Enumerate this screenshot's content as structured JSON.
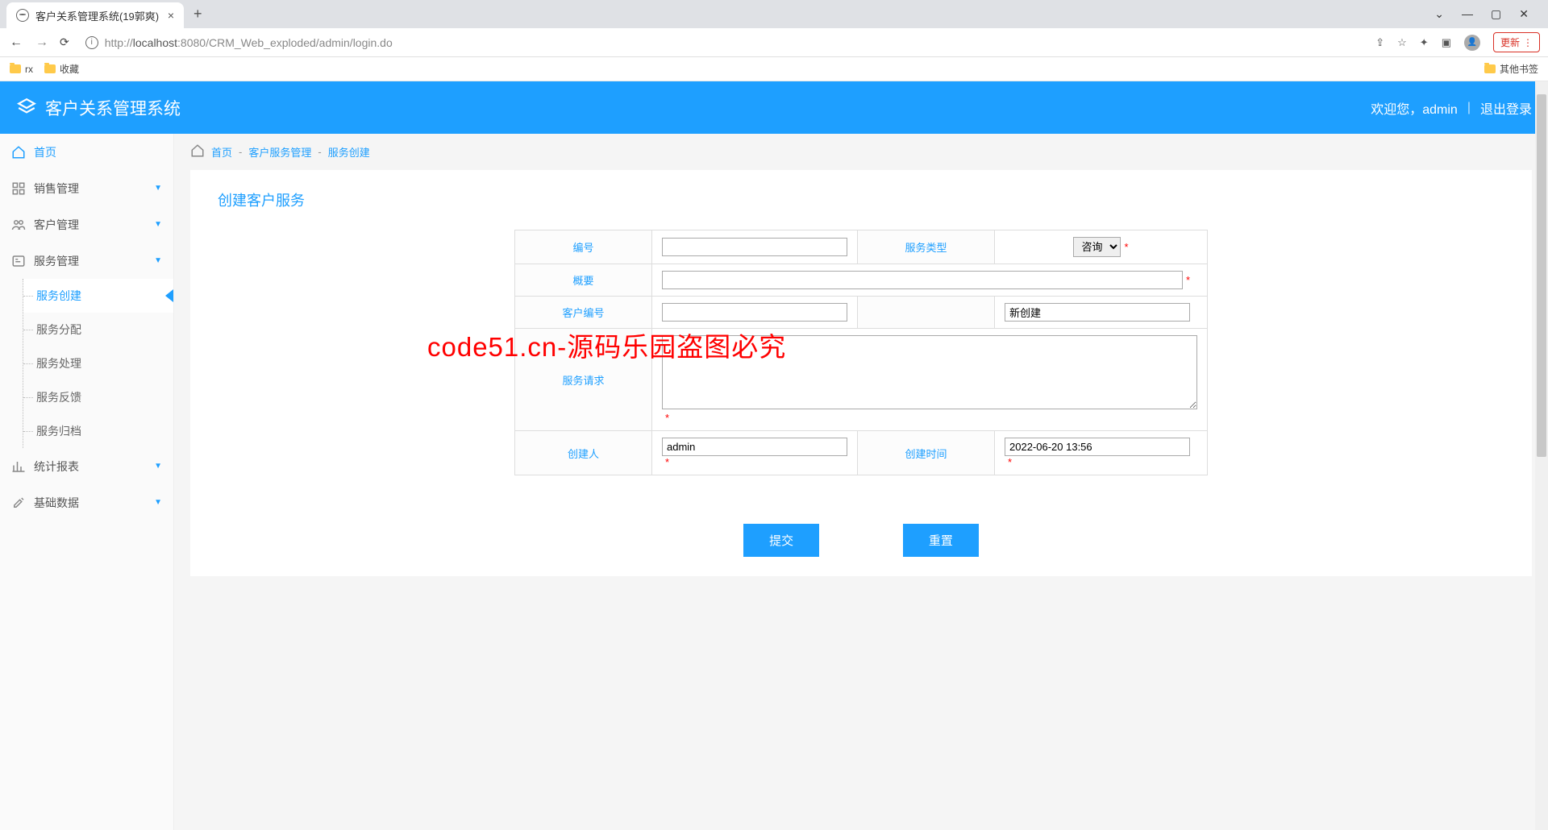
{
  "browser": {
    "tab_title": "客户关系管理系统(19郭爽)",
    "url_prefix": "http://",
    "url_host": "localhost",
    "url_port": ":8080",
    "url_path": "/CRM_Web_exploded/admin/login.do",
    "update_label": "更新",
    "bookmarks": {
      "rx": "rx",
      "fav": "收藏",
      "other": "其他书签"
    }
  },
  "header": {
    "title": "客户关系管理系统",
    "welcome": "欢迎您，",
    "user": "admin",
    "logout": "退出登录"
  },
  "sidebar": {
    "home": "首页",
    "sales": "销售管理",
    "customer": "客户管理",
    "service": "服务管理",
    "service_sub": [
      "服务创建",
      "服务分配",
      "服务处理",
      "服务反馈",
      "服务归档"
    ],
    "stats": "统计报表",
    "base": "基础数据"
  },
  "breadcrumb": {
    "home": "首页",
    "svc_mgmt": "客户服务管理",
    "svc_create": "服务创建"
  },
  "panel": {
    "title": "创建客户服务"
  },
  "form": {
    "id_label": "编号",
    "id_value": "",
    "type_label": "服务类型",
    "type_value": "咨询",
    "summary_label": "概要",
    "summary_value": "",
    "customer_label": "客户编号",
    "customer_value": "",
    "status_value": "新创建",
    "request_label": "服务请求",
    "request_value": "",
    "creator_label": "创建人",
    "creator_value": "admin",
    "create_time_label": "创建时间",
    "create_time_value": "2022-06-20 13:56"
  },
  "buttons": {
    "submit": "提交",
    "reset": "重置"
  },
  "watermark": "code51.cn-源码乐园盗图必究"
}
